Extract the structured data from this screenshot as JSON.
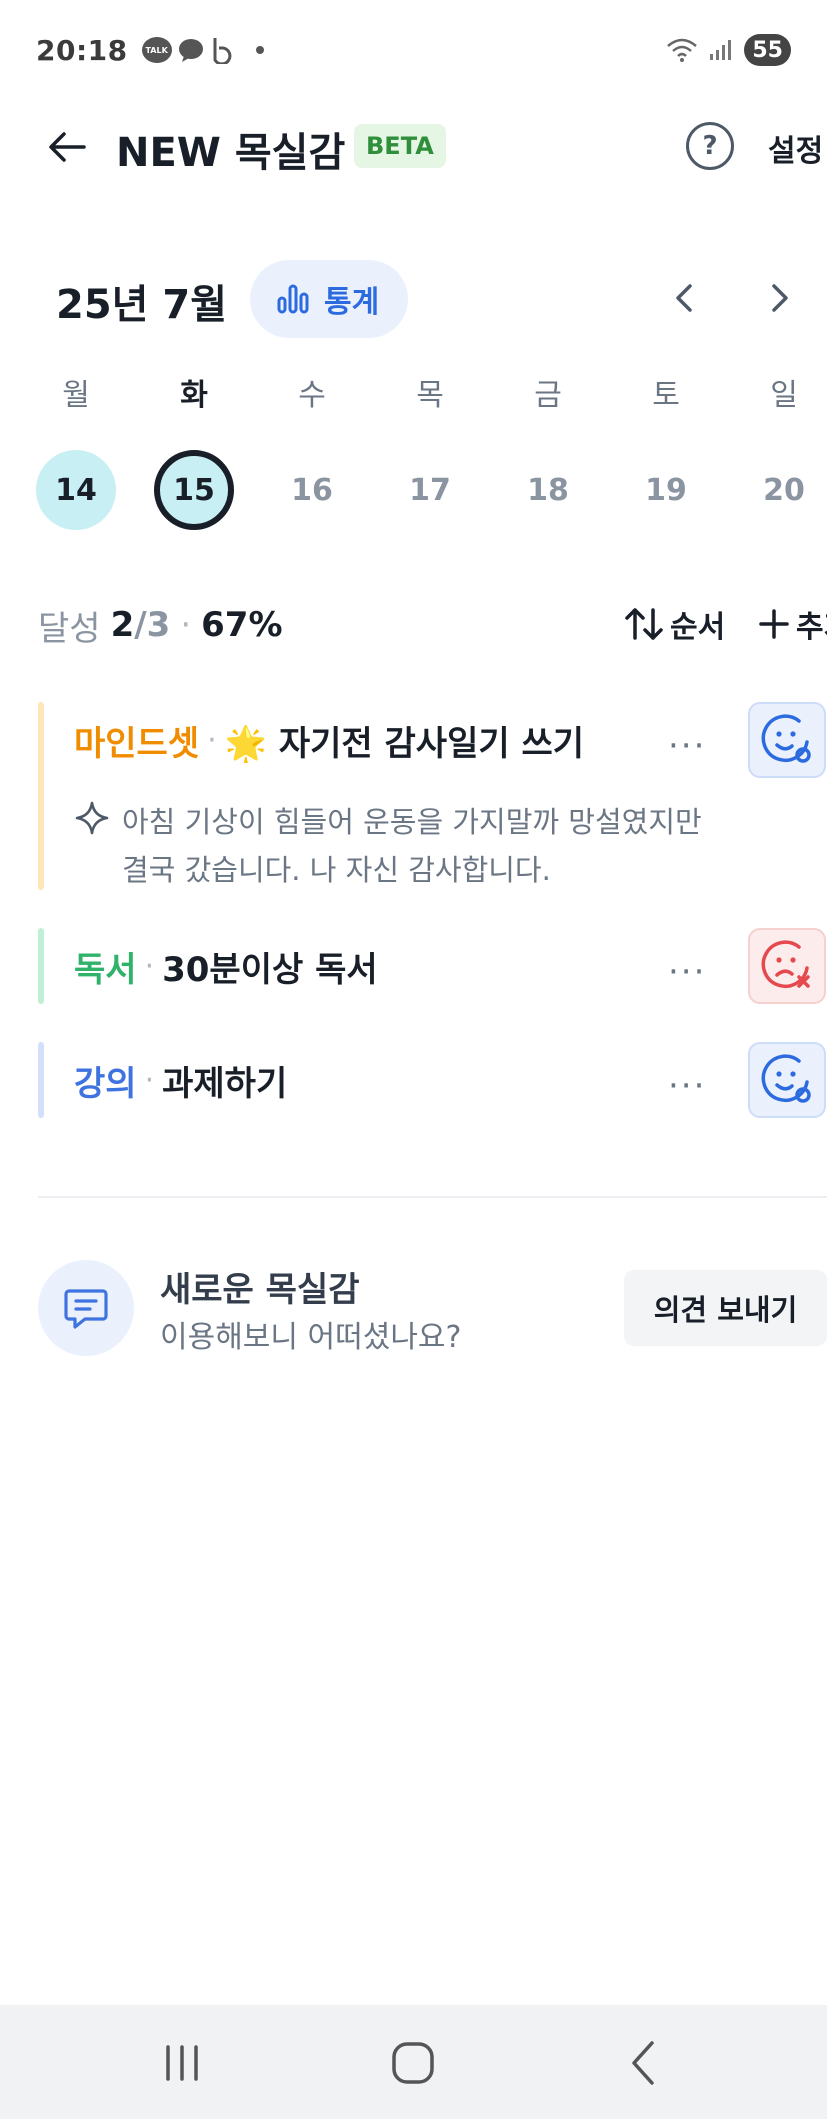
{
  "status_bar": {
    "time": "20:18",
    "battery": "55"
  },
  "header": {
    "title": "NEW 목실감",
    "badge": "BETA",
    "settings_label": "설정",
    "help_glyph": "?"
  },
  "calendar": {
    "month_label": "25년 7월",
    "stats_label": "통계",
    "days": [
      {
        "name": "월",
        "date": "14",
        "state": "done"
      },
      {
        "name": "화",
        "date": "15",
        "state": "today"
      },
      {
        "name": "수",
        "date": "16",
        "state": "none"
      },
      {
        "name": "목",
        "date": "17",
        "state": "none"
      },
      {
        "name": "금",
        "date": "18",
        "state": "none"
      },
      {
        "name": "토",
        "date": "19",
        "state": "none"
      },
      {
        "name": "일",
        "date": "20",
        "state": "none"
      }
    ]
  },
  "summary": {
    "label": "달성",
    "done": "2",
    "total": "/3",
    "separator": "·",
    "percent": "67%",
    "order_label": "순서",
    "add_label": "추가"
  },
  "tasks": [
    {
      "category": "마인드셋",
      "category_color": "#f08c00",
      "bar_color": "#fde7b8",
      "title": "🌟 자기전 감사일기 쓰기",
      "status": "success",
      "note": "아침 기상이 힘들어 운동을 가지말까 망설였지만 결국 갔습니다. 나 자신 감사합니다."
    },
    {
      "category": "독서",
      "category_color": "#2fb36b",
      "bar_color": "#bff0d6",
      "title": "30분이상 독서",
      "status": "fail"
    },
    {
      "category": "강의",
      "category_color": "#3f73e0",
      "bar_color": "#d3e0fb",
      "title": "과제하기",
      "status": "success"
    }
  ],
  "feedback": {
    "title": "새로운 목실감",
    "subtitle": "이용해보니 어떠셨나요?",
    "button": "의견 보내기"
  },
  "icons": {
    "back": "arrow-left-icon",
    "help": "question-circle-icon",
    "stats": "bar-chart-icon",
    "prev": "chevron-left-icon",
    "next": "chevron-right-icon",
    "order": "sort-arrows-icon",
    "add": "plus-icon",
    "more": "more-dots-icon",
    "success": "smile-check-icon",
    "fail": "frown-x-icon",
    "note": "sparkle-icon",
    "chat": "chat-icon"
  },
  "colors": {
    "accent": "#2c6adf",
    "success_bg": "#eaf1fd",
    "fail_bg": "#fdecec",
    "today_ring": "#191f28",
    "done_fill": "#c8f0f4"
  }
}
